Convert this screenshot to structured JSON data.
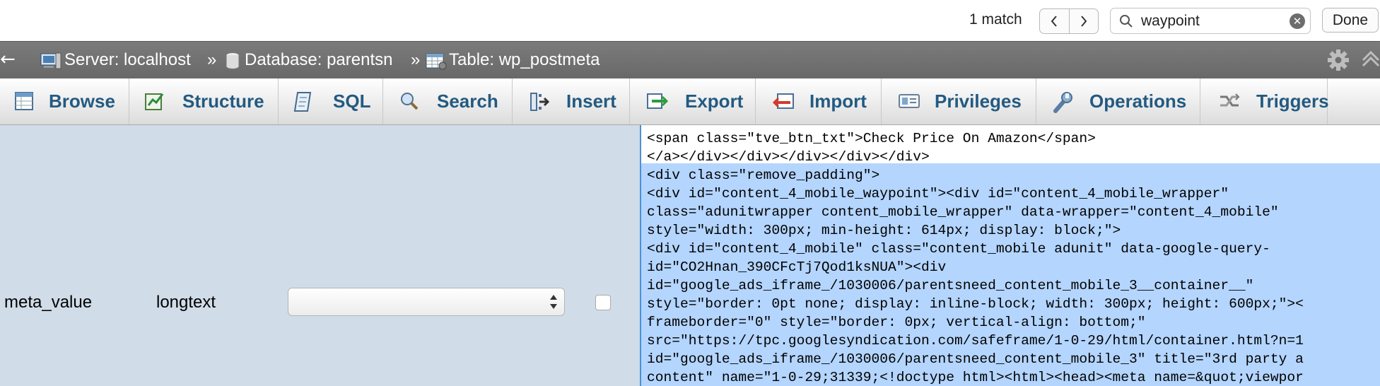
{
  "find_bar": {
    "match_count": "1 match",
    "prev_label": "<",
    "next_label": ">",
    "search_value": "waypoint",
    "done_label": "Done"
  },
  "breadcrumb": {
    "server": "Server: localhost",
    "database": "Database: parentsn",
    "table": "Table: wp_postmeta",
    "separator": "»"
  },
  "tabs": [
    {
      "label": "Browse",
      "icon": "browse-icon"
    },
    {
      "label": "Structure",
      "icon": "structure-icon"
    },
    {
      "label": "SQL",
      "icon": "sql-icon"
    },
    {
      "label": "Search",
      "icon": "search-icon"
    },
    {
      "label": "Insert",
      "icon": "insert-icon"
    },
    {
      "label": "Export",
      "icon": "export-icon"
    },
    {
      "label": "Import",
      "icon": "import-icon"
    },
    {
      "label": "Privileges",
      "icon": "privileges-icon"
    },
    {
      "label": "Operations",
      "icon": "operations-icon"
    },
    {
      "label": "Triggers",
      "icon": "triggers-icon"
    }
  ],
  "row": {
    "column_name": "meta_value",
    "type": "longtext",
    "function_value": ""
  },
  "editor": {
    "lines": [
      "<span class=\"tve_btn_txt\">Check Price On Amazon</span>",
      "</a></div></div></div></div></div>",
      "<div class=\"remove_padding\">",
      "<div id=\"content_4_mobile_waypoint\"><div id=\"content_4_mobile_wrapper\"",
      "class=\"adunitwrapper content_mobile_wrapper\" data-wrapper=\"content_4_mobile\"",
      "style=\"width: 300px; min-height: 614px; display: block;\">",
      "<div id=\"content_4_mobile\" class=\"content_mobile adunit\" data-google-query-",
      "id=\"CO2Hnan_390CFcTj7Qod1ksNUA\"><div",
      "id=\"google_ads_iframe_/1030006/parentsneed_content_mobile_3__container__\"",
      "style=\"border: 0pt none; display: inline-block; width: 300px; height: 600px;\"><",
      "frameborder=\"0\" style=\"border: 0px; vertical-align: bottom;\"",
      "src=\"https://tpc.googlesyndication.com/safeframe/1-0-29/html/container.html?n=1",
      "id=\"google_ads_iframe_/1030006/parentsneed_content_mobile_3\" title=\"3rd party a",
      "content\" name=\"1-0-29;31339;<!doctype html><html><head><meta name=&quot;viewpor"
    ]
  },
  "colors": {
    "tab_text": "#235a81",
    "breadcrumb_bg": "#707070",
    "content_bg": "#d0dce8",
    "selection": "#b4d5fe"
  }
}
